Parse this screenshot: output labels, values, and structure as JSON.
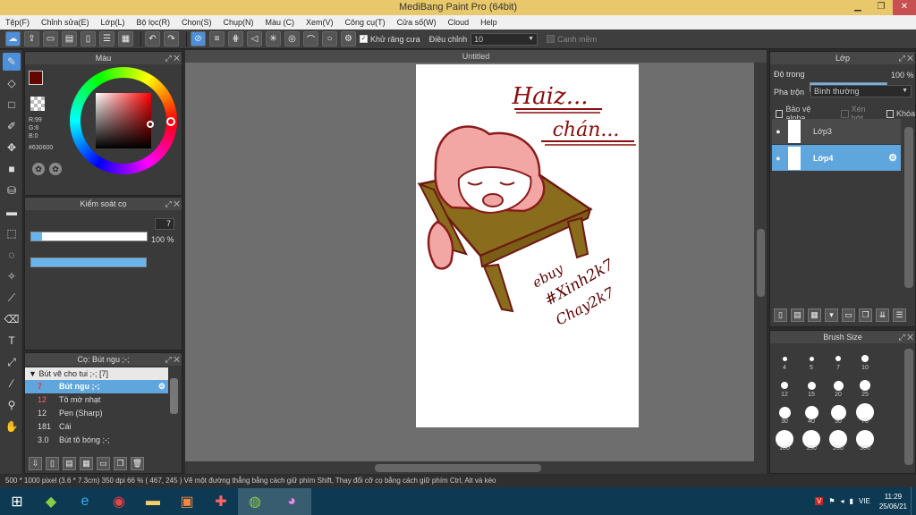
{
  "window": {
    "title": "MediBang Paint Pro (64bit)"
  },
  "menu": [
    "Tệp(F)",
    "Chỉnh sửa(E)",
    "Lớp(L)",
    "Bộ lọc(R)",
    "Chọn(S)",
    "Chụp(N)",
    "Màu (C)",
    "Xem(V)",
    "Công cụ(T)",
    "Cửa số(W)",
    "Cloud",
    "Help"
  ],
  "toolbar": {
    "antialias_label": "Khử răng cưa",
    "adjust_label": "Điều chỉnh",
    "adjust_value": "10",
    "edge_label": "Canh mềm"
  },
  "color_panel": {
    "title": "Màu",
    "r": "R:99",
    "g": "G:6",
    "b": "B:0",
    "hex": "#630600",
    "fg_color": "#630600"
  },
  "brush_control": {
    "title": "Kiểm soát cọ",
    "size_value": "7",
    "opacity_value": "100 %",
    "opacity": 1.0
  },
  "brush_panel": {
    "title": "Cọ: Bút ngu ;-;",
    "group": "Bút vẽ cho tui ;-; [7]",
    "items": [
      {
        "size": "7",
        "name": "Bút ngu ;-;"
      },
      {
        "size": "12",
        "name": "Tô mờ nhạt"
      },
      {
        "size": "12",
        "name": "Pen (Sharp)"
      },
      {
        "size": "181",
        "name": "Cái"
      },
      {
        "size": "3.0",
        "name": "Bút tô bóng ;-;"
      }
    ]
  },
  "canvas": {
    "tab_title": "Untitled"
  },
  "drawing_text": {
    "title1": "Haiz...",
    "title2": "chán...",
    "sig1": "ebuy",
    "sig2": "#Xinh2k7",
    "sig3": "Chay2k7"
  },
  "layer_panel": {
    "title": "Lớp",
    "opacity_label": "Độ trong",
    "opacity_value": "100 %",
    "opacity": 1.0,
    "blend_label": "Pha trộn",
    "blend_value": "Bình thường",
    "protect_alpha": "Bảo vệ alpha",
    "clip": "Xén bớt",
    "lock": "Khóa",
    "layers": [
      {
        "name": "Lớp3"
      },
      {
        "name": "Lớp4"
      }
    ]
  },
  "brush_size_panel": {
    "title": "Brush Size",
    "sizes": [
      "4",
      "5",
      "7",
      "10",
      "12",
      "15",
      "20",
      "25",
      "30",
      "40",
      "50",
      "70",
      "100",
      "150",
      "200",
      "300"
    ]
  },
  "status": "500 * 1000 pixel   (3.6 * 7.3cm)   350 dpi   66 %   ( 467, 245 )   Vẽ một đường thẳng bằng cách giữ phím Shift, Thay đổi cỡ cọ bằng cách giữ phím Ctrl, Alt và kéo",
  "tray": {
    "lang": "VIE",
    "time": "11:29",
    "date": "25/06/21"
  }
}
